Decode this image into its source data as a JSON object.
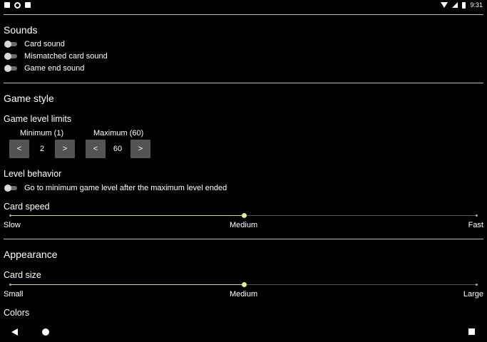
{
  "status_bar": {
    "time": "9:31"
  },
  "sounds": {
    "title": "Sounds",
    "toggles": [
      {
        "label": "Card sound",
        "on": false
      },
      {
        "label": "Mismatched card sound",
        "on": false
      },
      {
        "label": "Game end sound",
        "on": false
      }
    ]
  },
  "game_style": {
    "title": "Game style",
    "level_limits": {
      "title": "Game level limits",
      "minimum": {
        "label": "Minimum (1)",
        "value": "2",
        "dec": "<",
        "inc": ">"
      },
      "maximum": {
        "label": "Maximum (60)",
        "value": "60",
        "dec": "<",
        "inc": ">"
      }
    },
    "level_behavior": {
      "title": "Level behavior",
      "toggle_label": "Go to minimum game level after the maximum level ended",
      "on": false
    },
    "card_speed": {
      "title": "Card speed",
      "min_label": "Slow",
      "mid_label": "Medium",
      "max_label": "Fast",
      "value_fraction": 0.5
    }
  },
  "appearance": {
    "title": "Appearance",
    "card_size": {
      "title": "Card size",
      "min_label": "Small",
      "mid_label": "Medium",
      "max_label": "Large",
      "value_fraction": 0.5
    },
    "colors_title": "Colors"
  },
  "colors": {
    "accent": "#e7ec8f",
    "background": "#000000",
    "button": "#545454"
  }
}
